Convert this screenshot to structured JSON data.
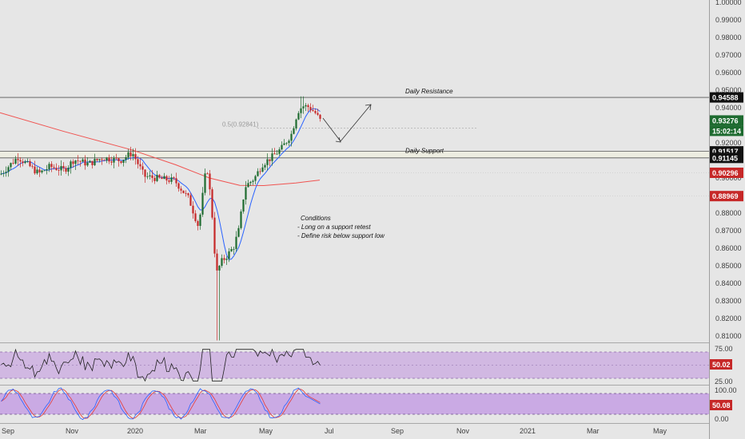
{
  "colors": {
    "background": "#e6e6e6",
    "candle_up": "#1e6b30",
    "candle_down": "#c62828",
    "ma_fast": "#2962ff",
    "ma_slow": "#f05350",
    "zone_line": "#555555",
    "rsi_band_fill": "#c9a8e0",
    "rsi_line": "#222222",
    "stoch_band_fill": "#c39be3",
    "stoch_k": "#2962ff",
    "stoch_d": "#e53935"
  },
  "price_axis": {
    "ticks": [
      "1.00000",
      "0.99000",
      "0.98000",
      "0.97000",
      "0.96000",
      "0.95000",
      "0.94000",
      "0.93000",
      "0.92000",
      "0.91000",
      "0.90000",
      "0.89000",
      "0.88000",
      "0.87000",
      "0.86000",
      "0.85000",
      "0.84000",
      "0.83000",
      "0.82000",
      "0.81000"
    ]
  },
  "badges": [
    {
      "value": "0.94588",
      "bg": "#111111"
    },
    {
      "value": "0.93276",
      "bg": "#1e6b30"
    },
    {
      "value": "15:02:14",
      "bg": "#1e6b30"
    },
    {
      "value": "0.91517",
      "bg": "#111111"
    },
    {
      "value": "0.91145",
      "bg": "#111111"
    },
    {
      "value": "0.90296",
      "bg": "#c62828"
    },
    {
      "value": "0.88969",
      "bg": "#c62828"
    }
  ],
  "rsi_panel": {
    "ticks": [
      "75.00",
      "25.00"
    ],
    "value_badge": "50.02",
    "badge_bg": "#c62828",
    "upper": 75,
    "lower": 25,
    "mid": 50
  },
  "stoch_panel": {
    "ticks": [
      "100.00",
      "0.00"
    ],
    "value_badge": "50.08",
    "badge_bg": "#c62828",
    "upper": 80,
    "lower": 20
  },
  "time_axis": {
    "labels": [
      "Sep",
      "Nov",
      "2020",
      "Mar",
      "May",
      "Jul",
      "Sep",
      "Nov",
      "2021",
      "Mar",
      "May"
    ]
  },
  "annotations": {
    "resistance_label": "Daily Resistance",
    "support_label": "Daily Support",
    "fib_label": "0.5(0.92841)",
    "conditions": [
      "Conditions",
      "- Long on a support retest",
      "- Define risk below support low"
    ]
  },
  "chart_data": {
    "type": "candlestick",
    "title": "",
    "xlabel": "",
    "ylabel": "",
    "ylim": [
      0.805,
      1.003
    ],
    "grid": false,
    "levels": {
      "daily_resistance": 0.94588,
      "daily_support_top": 0.91517,
      "daily_support_bottom": 0.91145,
      "fib_0_5": 0.92841
    },
    "last_price": 0.93276,
    "price_path": [
      {
        "x": "Aug 2019",
        "y": 0.902
      },
      {
        "x": "Sep 2019",
        "y": 0.912
      },
      {
        "x": "Oct 2019",
        "y": 0.906
      },
      {
        "x": "Nov 2019",
        "y": 0.908
      },
      {
        "x": "Dec 2019",
        "y": 0.907
      },
      {
        "x": "Jan 2020",
        "y": 0.912
      },
      {
        "x": "Feb 2020",
        "y": 0.895
      },
      {
        "x": "Mar 2020",
        "y": 0.84
      },
      {
        "x": "Apr 2020",
        "y": 0.87
      },
      {
        "x": "May 2020",
        "y": 0.915
      },
      {
        "x": "Jun 2020",
        "y": 0.942
      },
      {
        "x": "Jun 2020 end",
        "y": 0.9328
      }
    ],
    "extremes": {
      "high": 0.9465,
      "low": 0.8075
    },
    "ma_slow_path": [
      {
        "x": "Aug 2019",
        "y": 0.9372
      },
      {
        "x": "Nov 2019",
        "y": 0.923
      },
      {
        "x": "Jan 2020",
        "y": 0.9145
      },
      {
        "x": "Mar 2020",
        "y": 0.901
      },
      {
        "x": "May 2020",
        "y": 0.8955
      },
      {
        "x": "Jul 2020",
        "y": 0.898
      }
    ],
    "rsi": {
      "last": 50.02,
      "overbought": 75,
      "oversold": 25
    },
    "stochastic": {
      "last": 50.08,
      "upper": 80,
      "lower": 20
    }
  }
}
